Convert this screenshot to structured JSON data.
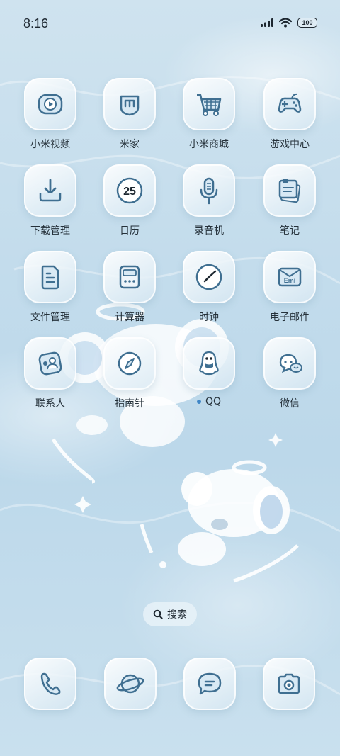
{
  "status_bar": {
    "time": "8:16",
    "battery": "100"
  },
  "apps": {
    "mi_video": {
      "label": "小米视频"
    },
    "mi_home": {
      "label": "米家"
    },
    "mi_store": {
      "label": "小米商城"
    },
    "game_center": {
      "label": "游戏中心"
    },
    "downloads": {
      "label": "下载管理"
    },
    "calendar": {
      "label": "日历",
      "date": "25"
    },
    "recorder": {
      "label": "录音机"
    },
    "notes": {
      "label": "笔记"
    },
    "file_manager": {
      "label": "文件管理"
    },
    "calculator": {
      "label": "计算器"
    },
    "clock": {
      "label": "时钟"
    },
    "email": {
      "label": "电子邮件",
      "icon_text": "Emi"
    },
    "contacts": {
      "label": "联系人"
    },
    "compass": {
      "label": "指南针"
    },
    "qq": {
      "label": "QQ"
    },
    "wechat": {
      "label": "微信"
    }
  },
  "search": {
    "label": "搜索"
  },
  "dock": [
    "phone-icon",
    "browser-planet-icon",
    "messages-icon",
    "camera-icon"
  ],
  "colors": {
    "icon_stroke": "#3f6f91",
    "icon_fill_light": "#d8e9f4",
    "accent_dot": "#3f86c6"
  }
}
